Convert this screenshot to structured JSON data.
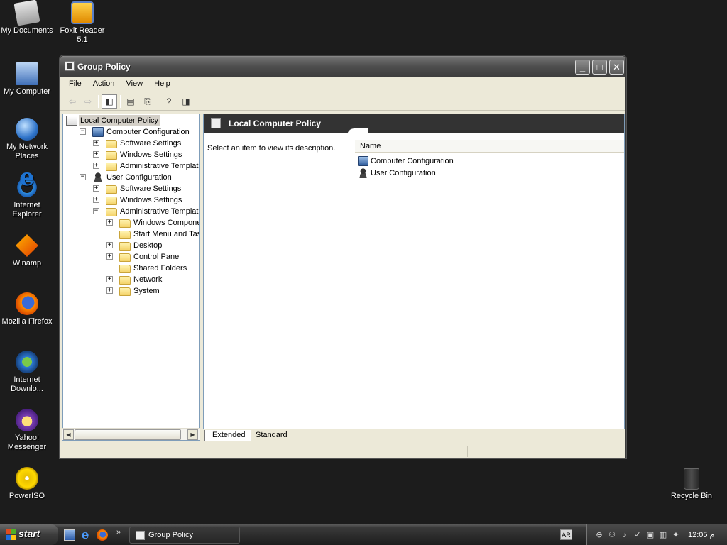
{
  "desktop": {
    "icons": [
      {
        "label": "My Documents",
        "icon": "my-documents-icon"
      },
      {
        "label": "Foxit Reader 5.1",
        "icon": "foxit-reader-icon"
      },
      {
        "label": "My Computer",
        "icon": "my-computer-icon"
      },
      {
        "label": "My Network Places",
        "icon": "network-places-icon"
      },
      {
        "label": "Internet Explorer",
        "icon": "internet-explorer-icon"
      },
      {
        "label": "Winamp",
        "icon": "winamp-icon"
      },
      {
        "label": "Mozilla Firefox",
        "icon": "firefox-icon"
      },
      {
        "label": "Internet Downlo...",
        "icon": "download-manager-icon"
      },
      {
        "label": "Yahoo! Messenger",
        "icon": "yahoo-messenger-icon"
      },
      {
        "label": "PowerISO",
        "icon": "poweriso-icon"
      },
      {
        "label": "Recycle Bin",
        "icon": "recycle-bin-icon"
      }
    ]
  },
  "window": {
    "title": "Group Policy",
    "menu": [
      "File",
      "Action",
      "View",
      "Help"
    ],
    "toolbar": [
      "back-arrow-icon",
      "forward-arrow-icon",
      "show-hide-tree-icon",
      "properties-icon",
      "export-list-icon",
      "help-icon",
      "show-hide-action-pane-icon"
    ],
    "tree": [
      {
        "label": "Local Computer Policy",
        "icon": "policy",
        "exp": "",
        "selected": true
      },
      {
        "label": "Computer Configuration",
        "icon": "comp",
        "exp": "−"
      },
      {
        "label": "Software Settings",
        "icon": "folder",
        "exp": "+"
      },
      {
        "label": "Windows Settings",
        "icon": "folder",
        "exp": "+"
      },
      {
        "label": "Administrative Templates",
        "icon": "folder",
        "exp": "+"
      },
      {
        "label": "User Configuration",
        "icon": "user",
        "exp": "−"
      },
      {
        "label": "Software Settings",
        "icon": "folder",
        "exp": "+"
      },
      {
        "label": "Windows Settings",
        "icon": "folder",
        "exp": "+"
      },
      {
        "label": "Administrative Templates",
        "icon": "folder",
        "exp": "−"
      },
      {
        "label": "Windows Components",
        "icon": "folder",
        "exp": "+"
      },
      {
        "label": "Start Menu and Taskba",
        "icon": "folder",
        "exp": ""
      },
      {
        "label": "Desktop",
        "icon": "folder",
        "exp": "+"
      },
      {
        "label": "Control Panel",
        "icon": "folder",
        "exp": "+"
      },
      {
        "label": "Shared Folders",
        "icon": "folder",
        "exp": ""
      },
      {
        "label": "Network",
        "icon": "folder",
        "exp": "+"
      },
      {
        "label": "System",
        "icon": "folder",
        "exp": "+"
      }
    ],
    "right_pane": {
      "header": "Local Computer Policy",
      "description": "Select an item to view its description.",
      "column_name": "Name",
      "items": [
        {
          "label": "Computer Configuration",
          "icon": "comp"
        },
        {
          "label": "User Configuration",
          "icon": "user"
        }
      ]
    },
    "tabs": [
      "Extended",
      "Standard"
    ]
  },
  "taskbar": {
    "start_label": "start",
    "task_button": "Group Policy",
    "language": "AR",
    "clock": "12:05 م"
  }
}
